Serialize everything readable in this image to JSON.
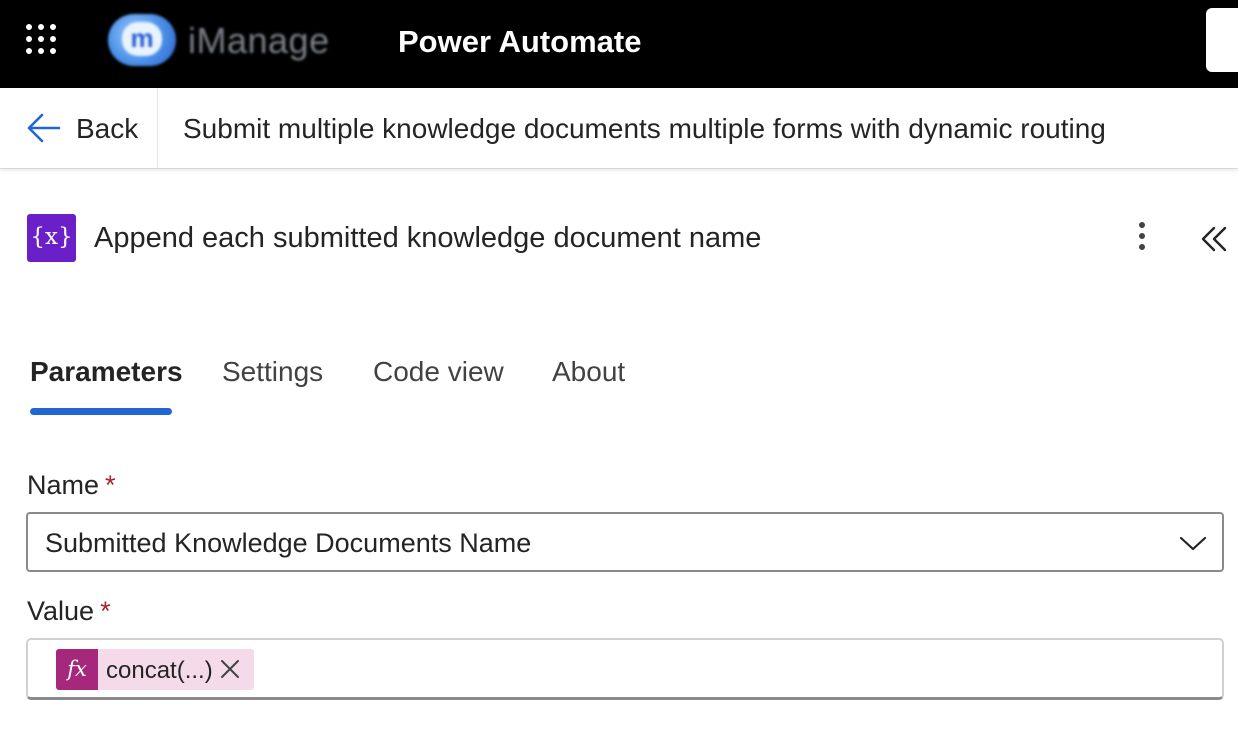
{
  "topbar": {
    "app_title": "Power Automate",
    "logo_text": "iManage",
    "logo_mark": "m"
  },
  "header": {
    "back_label": "Back",
    "flow_title": "Submit multiple knowledge documents multiple forms with dynamic routing"
  },
  "action": {
    "icon_text": "{x}",
    "title": "Append each submitted knowledge document name"
  },
  "tabs": [
    {
      "label": "Parameters",
      "active": true
    },
    {
      "label": "Settings",
      "active": false
    },
    {
      "label": "Code view",
      "active": false
    },
    {
      "label": "About",
      "active": false
    }
  ],
  "form": {
    "name_label": "Name",
    "name_value": "Submitted Knowledge Documents Name",
    "value_label": "Value",
    "required_mark": "*",
    "token_icon": "fx",
    "token_label": "concat(...)"
  },
  "colors": {
    "topbar_bg": "#000000",
    "accent": "#2266d4",
    "action_icon_bg": "#6a1fc9",
    "token_bg": "#f5dbea",
    "token_icon_bg": "#a6287d",
    "required": "#a4262c"
  },
  "icons": [
    "waffle-icon",
    "back-arrow-icon",
    "variable-icon",
    "more-vertical-icon",
    "collapse-double-chevron-icon",
    "chevron-down-icon",
    "function-icon",
    "close-icon"
  ]
}
